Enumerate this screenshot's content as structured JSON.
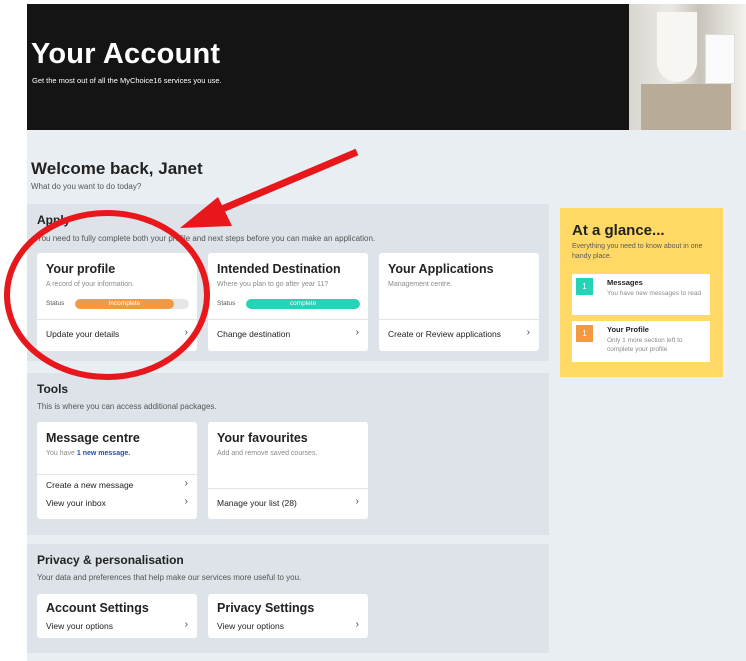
{
  "hero": {
    "title": "Your Account",
    "subtitle": "Get the most out of all the MyChoice16 services you use."
  },
  "welcome": {
    "title": "Welcome back, Janet",
    "subtitle": "What do you want to do today?"
  },
  "apply": {
    "title": "Apply",
    "subtitle": "You need to fully complete both your profile and next steps before you can make an application.",
    "cards": [
      {
        "title": "Your profile",
        "desc": "A record of your information.",
        "status_label": "Status",
        "status_text": "incomplete",
        "status_color": "#f29a43",
        "status_progress": 0.87,
        "link": "Update your details"
      },
      {
        "title": "Intended Destination",
        "desc": "Where you plan to go after year 11?",
        "status_label": "Status",
        "status_text": "complete",
        "status_color": "#25d3b6",
        "status_progress": 1.0,
        "link": "Change destination"
      },
      {
        "title": "Your Applications",
        "desc": "Management centre.",
        "link": "Create or Review applications"
      }
    ]
  },
  "tools": {
    "title": "Tools",
    "subtitle": "This is where you can access additional packages.",
    "message_centre": {
      "title": "Message centre",
      "desc_prefix": "You have",
      "desc_link": "1 new message.",
      "links": [
        "Create a new message",
        "View your inbox"
      ]
    },
    "favourites": {
      "title": "Your favourites",
      "desc": "Add and remove saved courses.",
      "link": "Manage your list (28)"
    }
  },
  "privacy": {
    "title": "Privacy & personalisation",
    "subtitle": "Your data and preferences that help make our services more useful to you.",
    "cards": [
      {
        "title": "Account Settings",
        "link": "View your options"
      },
      {
        "title": "Privacy Settings",
        "link": "View your options"
      }
    ]
  },
  "glance": {
    "title": "At a glance...",
    "subtitle": "Everything you need to know about in one handy place.",
    "items": [
      {
        "num": "1",
        "color": "#25d3b6",
        "title": "Messages",
        "desc": "You have new messages to read"
      },
      {
        "num": "1",
        "color": "#f29a43",
        "title": "Your Profile",
        "desc": "Only 1 more section left to complete your profile"
      }
    ]
  },
  "icons": {
    "chevron": "›"
  },
  "colors": {
    "hero_bg": "#141414",
    "page_bg": "#e9eef2",
    "panel_bg": "#dde3e8",
    "glance_bg": "#ffd866",
    "annotation": "#e8171b"
  }
}
